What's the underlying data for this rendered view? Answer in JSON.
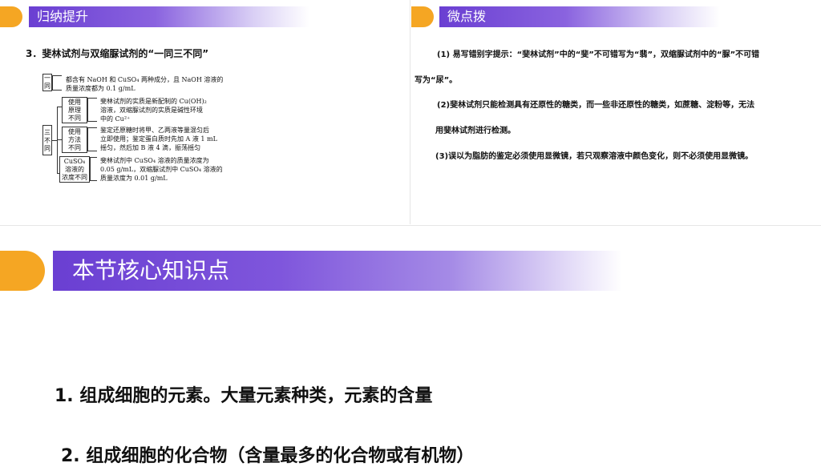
{
  "left_panel": {
    "tab_title": "归纳提升",
    "heading": "3．斐林试剂与双缩脲试剂的“一同三不同”",
    "diagram": {
      "same_label": [
        "一",
        "同"
      ],
      "same_text": [
        "都含有 NaOH 和 CuSO₄ 两种成分，且 NaOH 溶液的",
        "质量浓度都为 0.1 g/mL"
      ],
      "diff_label": [
        "三",
        "不",
        "同"
      ],
      "rows": [
        {
          "label": [
            "使用",
            "原理",
            "不同"
          ],
          "text": [
            "斐林试剂的实质是新配制的 Cu(OH)₂",
            "溶液，双缩脲试剂的实质是碱性环境",
            "中的 Cu²⁺"
          ]
        },
        {
          "label": [
            "使用",
            "方法",
            "不同"
          ],
          "text": [
            "鉴定还原糖时将甲、乙两液等量混匀后",
            "立即使用；鉴定蛋白质时先加 A 液 1 mL",
            "摇匀，然后加 B 液 4 滴，振荡摇匀"
          ]
        },
        {
          "label": [
            "CuSO₄",
            "溶液的",
            "浓度不同"
          ],
          "text": [
            "斐林试剂中 CuSO₄ 溶液的质量浓度为",
            "0.05 g/mL，双缩脲试剂中 CuSO₄ 溶液的",
            "质量浓度为 0.01 g/mL"
          ]
        }
      ]
    }
  },
  "right_panel": {
    "tab_title": "微点拨",
    "lines": [
      "(1) 易写错别字提示：“斐林试剂”中的“斐”不可错写为“翡”，双缩脲试剂中的“脲”不可错",
      "写为“尿”。",
      "(2)斐林试剂只能检测具有还原性的糖类，而一些非还原性的糖类，如蔗糖、淀粉等，无法",
      "用斐林试剂进行检测。",
      "(3)误以为脂肪的鉴定必须使用显微镜，若只观察溶液中颜色变化，则不必须使用显微镜。"
    ]
  },
  "section": {
    "title": "本节核心知识点",
    "points": [
      "1. 组成细胞的元素。大量元素种类，元素的含量",
      "2. 组成细胞的化合物（含量最多的化合物或有机物）"
    ]
  },
  "colors": {
    "accent_orange": "#f5a623",
    "accent_purple": "#6a3fd2"
  }
}
